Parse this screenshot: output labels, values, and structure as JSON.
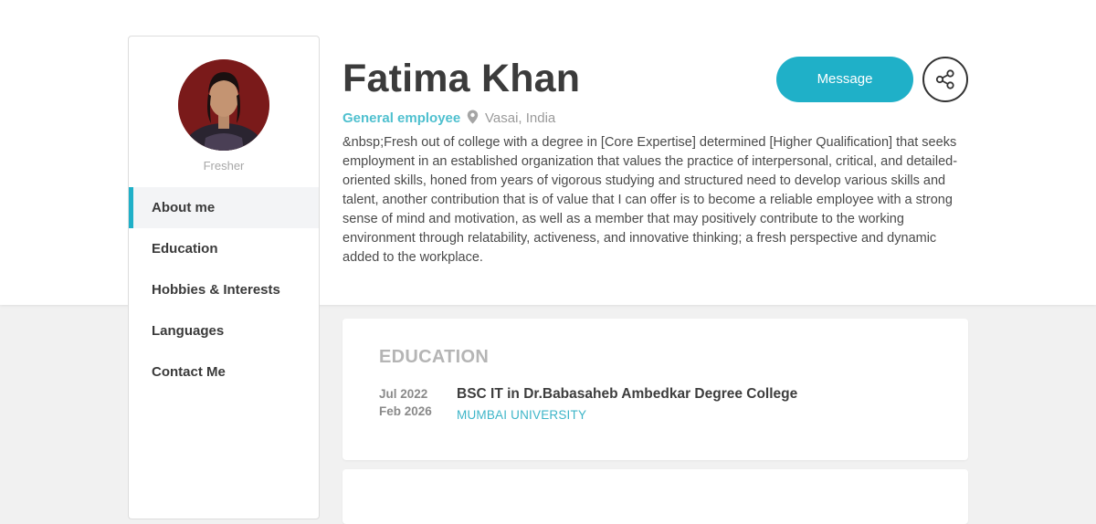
{
  "profile": {
    "name": "Fatima Khan",
    "role": "General employee",
    "location": "Vasai, India",
    "status": "Fresher",
    "about": "&nbsp;Fresh out of college with a degree in [Core Expertise] determined [Higher Qualification] that seeks employment in an established organization that values the practice of interpersonal, critical, and detailed-oriented skills, honed from years of vigorous studying and structured need to develop various skills and talent, another contribution that is of value that I can offer is to become a reliable employee with a strong sense of mind and motivation, as well as a member that may positively contribute to the working environment through relatability, activeness, and innovative thinking; a fresh perspective and dynamic added to the workplace."
  },
  "actions": {
    "message_label": "Message",
    "share_icon": "share-icon"
  },
  "nav": {
    "items": [
      {
        "label": "About me",
        "active": true
      },
      {
        "label": "Education",
        "active": false
      },
      {
        "label": "Hobbies & Interests",
        "active": false
      },
      {
        "label": "Languages",
        "active": false
      },
      {
        "label": "Contact Me",
        "active": false
      }
    ]
  },
  "education": {
    "title": "EDUCATION",
    "entries": [
      {
        "start": "Jul 2022",
        "end": "Feb 2026",
        "degree": "BSC IT in Dr.Babasaheb Ambedkar Degree College",
        "university": "MUMBAI UNIVERSITY"
      }
    ]
  },
  "colors": {
    "accent": "#1fb0c8",
    "background": "#f1f1f1"
  }
}
